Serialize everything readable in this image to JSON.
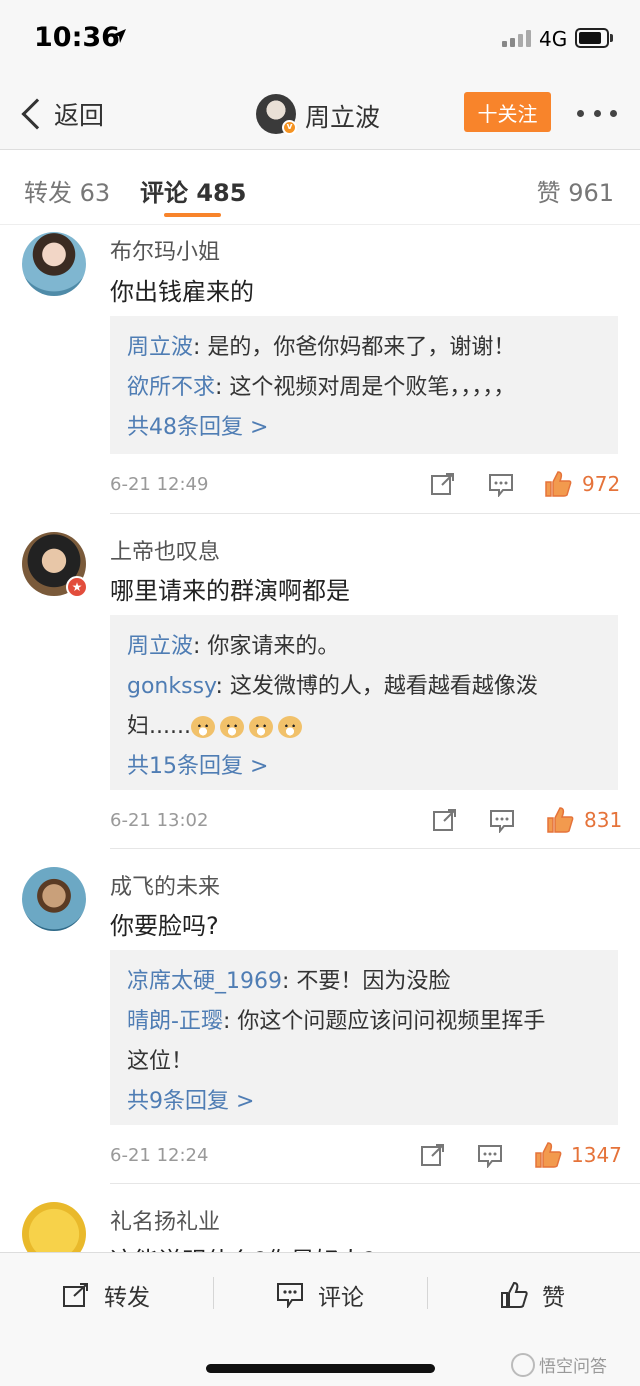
{
  "status": {
    "time": "10:36",
    "network": "4G"
  },
  "nav": {
    "back": "返回",
    "title": "周立波",
    "follow": "十关注"
  },
  "tabs": {
    "repost": "转发 63",
    "comment": "评论 485",
    "like": "赞 961"
  },
  "comments": [
    {
      "name": "布尔玛小姐",
      "text": "你出钱雇来的",
      "replies": [
        {
          "user": "周立波",
          "text": ": 是的，你爸你妈都来了，谢谢！"
        },
        {
          "user": "欲所不求",
          "text": ": 这个视频对周是个败笔，，，，，"
        }
      ],
      "more": "共48条回复 >",
      "time": "6-21 12:49",
      "likes": "972"
    },
    {
      "name": "上帝也叹息",
      "text": "哪里请来的群演啊都是",
      "replies": [
        {
          "user": "周立波",
          "text": ": 你家请来的。"
        },
        {
          "user": "gonkssy",
          "text": ": 这发微博的人，越看越看越像泼"
        },
        {
          "user": "",
          "text": "妇......"
        }
      ],
      "more": "共15条回复 >",
      "time": "6-21 13:02",
      "likes": "831"
    },
    {
      "name": "成飞的未来",
      "text": "你要脸吗?",
      "replies": [
        {
          "user": "凉席太硬_1969",
          "text": ": 不要！因为没脸"
        },
        {
          "user": "晴朗-正璎",
          "text": ": 你这个问题应该问问视频里挥手"
        },
        {
          "user": "",
          "text": "这位！"
        }
      ],
      "more": "共9条回复 >",
      "time": "6-21 12:24",
      "likes": "1347"
    },
    {
      "name": "礼名扬礼业",
      "text": "这能说明什么?你是好人?"
    }
  ],
  "bottom": {
    "repost": "转发",
    "comment": "评论",
    "like": "赞"
  },
  "watermark": "悟空问答",
  "colors": {
    "accent": "#f8842b",
    "link": "#4f7db4",
    "like": "#e5733a"
  }
}
